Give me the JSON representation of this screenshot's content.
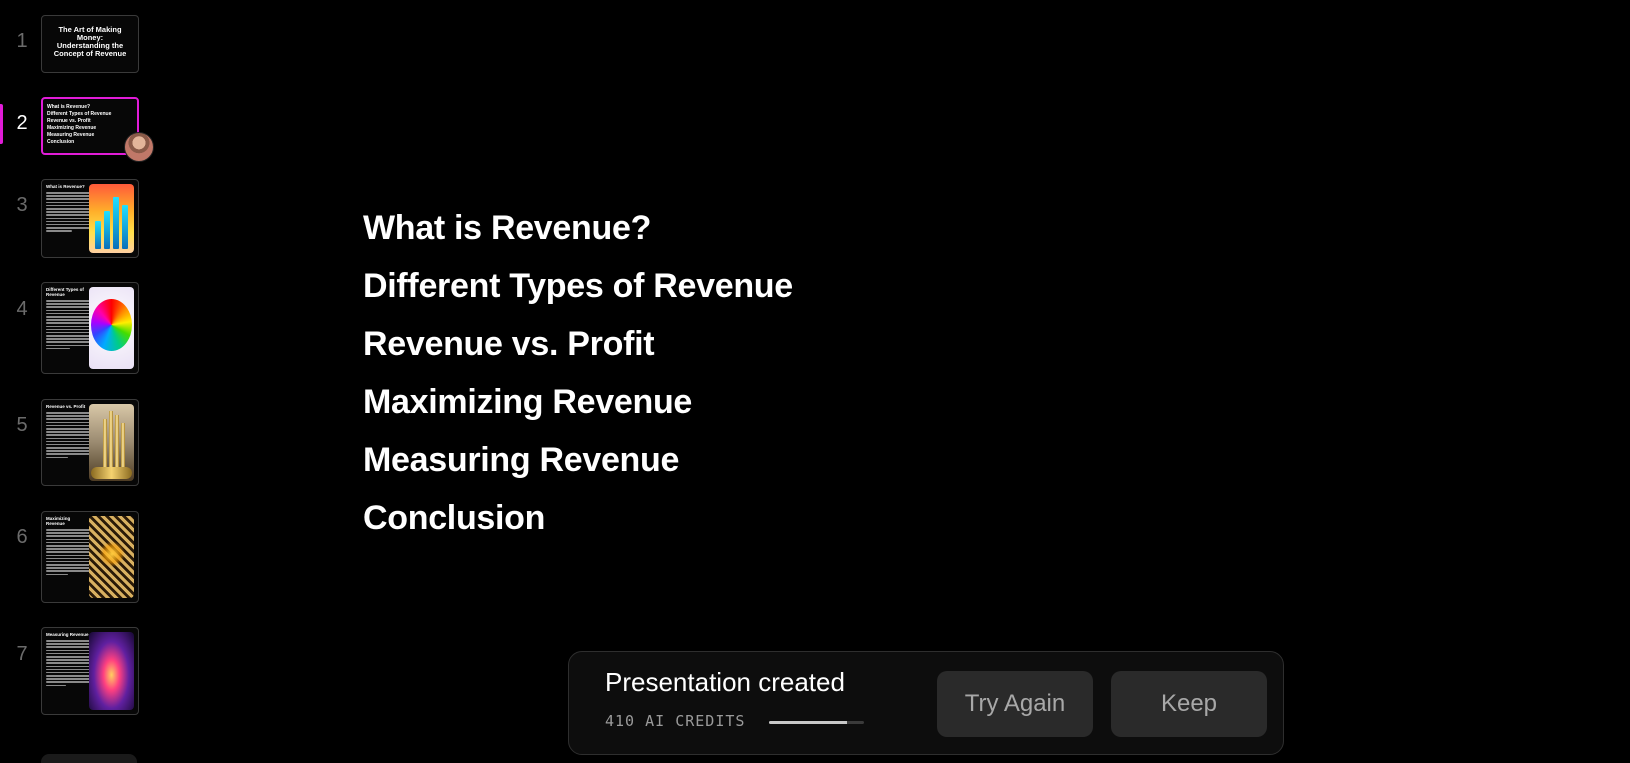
{
  "sidebar": {
    "slides": [
      {
        "number": "1",
        "title": "The Art of Making Money: Understanding the Concept of Revenue",
        "active": false
      },
      {
        "number": "2",
        "active": true,
        "items": [
          "What is Revenue?",
          "Different Types of Revenue",
          "Revenue vs. Profit",
          "Maximizing Revenue",
          "Measuring Revenue",
          "Conclusion"
        ]
      },
      {
        "number": "3",
        "title": "What is Revenue?",
        "image_icon": "bar-chart-image",
        "active": false
      },
      {
        "number": "4",
        "title": "Different Types of Revenue",
        "image_icon": "color-wheel-image",
        "active": false
      },
      {
        "number": "5",
        "title": "Revenue vs. Profit",
        "image_icon": "gold-columns-image",
        "active": false
      },
      {
        "number": "6",
        "title": "Maximizing Revenue",
        "image_icon": "golden-maze-image",
        "active": false
      },
      {
        "number": "7",
        "title": "Measuring Revenue",
        "image_icon": "light-rays-image",
        "active": false
      }
    ]
  },
  "main": {
    "items": [
      "What is Revenue?",
      "Different Types of Revenue",
      "Revenue vs. Profit",
      "Maximizing Revenue",
      "Measuring Revenue",
      "Conclusion"
    ]
  },
  "toast": {
    "title": "Presentation created",
    "credits_label": "410 AI CREDITS",
    "credits_progress": 0.82,
    "try_again_label": "Try Again",
    "keep_label": "Keep"
  },
  "colors": {
    "background": "#000000",
    "accent": "#e11cd8",
    "button_bg": "#2a2a2a",
    "toast_bg": "#0d0d0d"
  }
}
